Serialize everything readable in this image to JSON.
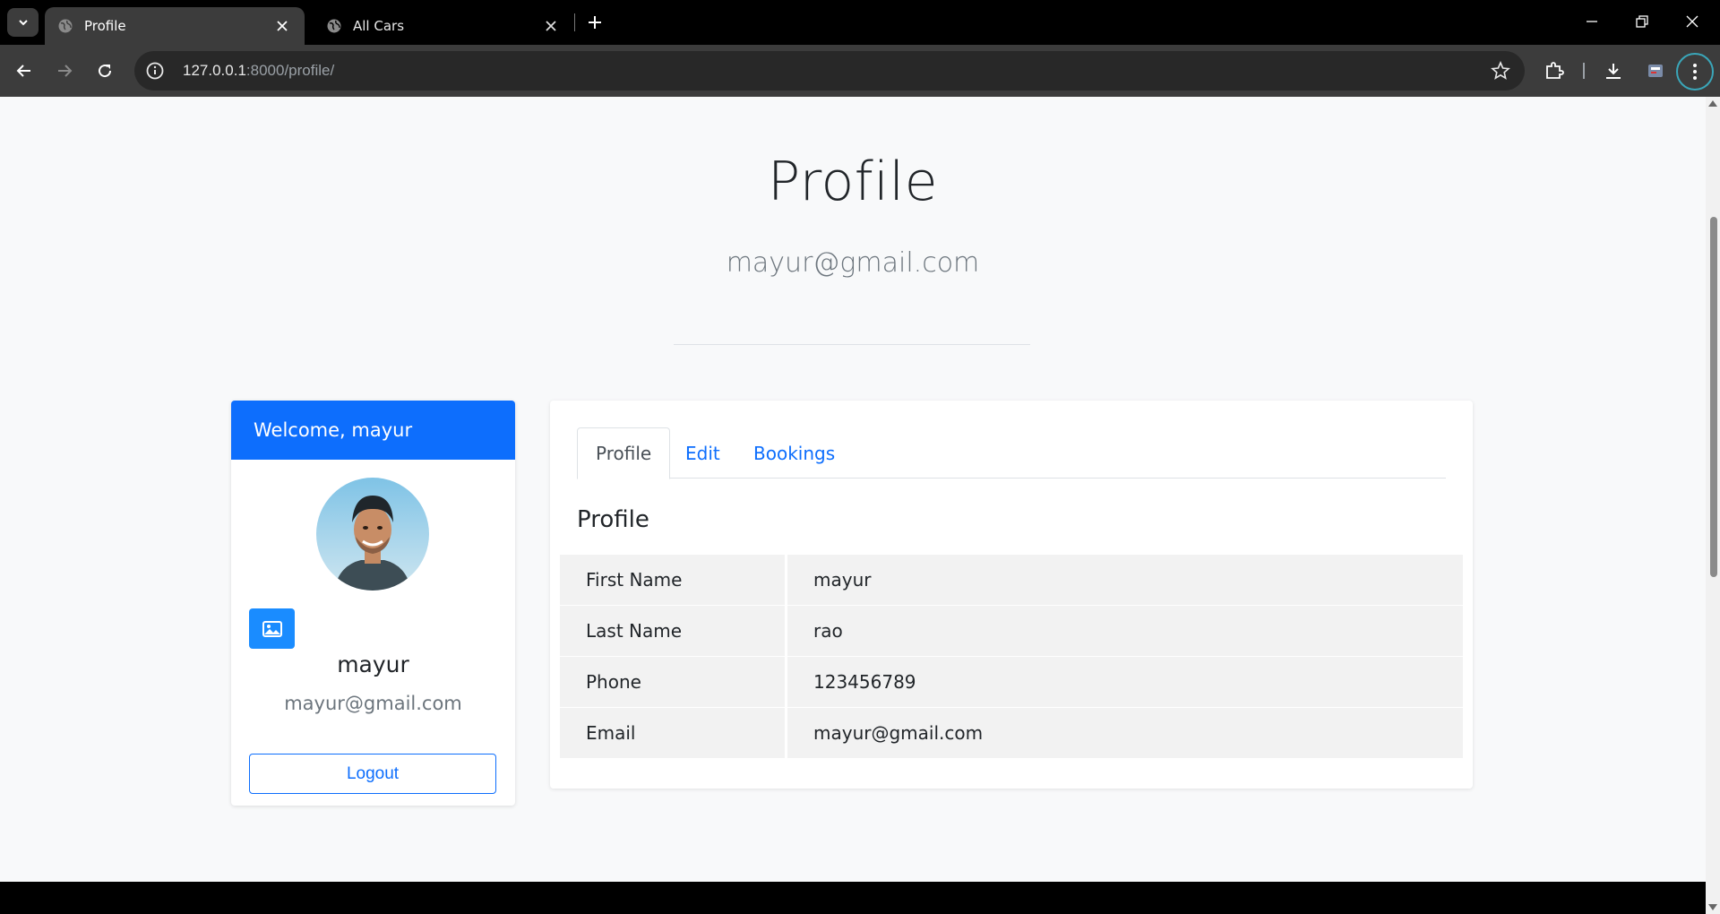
{
  "browser": {
    "tabs": [
      {
        "title": "Profile",
        "active": true
      },
      {
        "title": "All Cars",
        "active": false
      }
    ],
    "url_host": "127.0.0.1",
    "url_rest": ":8000/profile/"
  },
  "page": {
    "title": "Profile",
    "subtitle": "mayur@gmail.com"
  },
  "sidebar": {
    "welcome": "Welcome, mayur",
    "name": "mayur",
    "email": "mayur@gmail.com",
    "logout_label": "Logout"
  },
  "main": {
    "tabs": [
      {
        "label": "Profile",
        "active": true
      },
      {
        "label": "Edit",
        "active": false
      },
      {
        "label": "Bookings",
        "active": false
      }
    ],
    "section_title": "Profile",
    "rows": [
      {
        "key": "First Name",
        "value": "mayur"
      },
      {
        "key": "Last Name",
        "value": "rao"
      },
      {
        "key": "Phone",
        "value": "123456789"
      },
      {
        "key": "Email",
        "value": "mayur@gmail.com"
      }
    ]
  },
  "colors": {
    "primary": "#0d6efd",
    "chrome_dark": "#3c3c3c"
  }
}
